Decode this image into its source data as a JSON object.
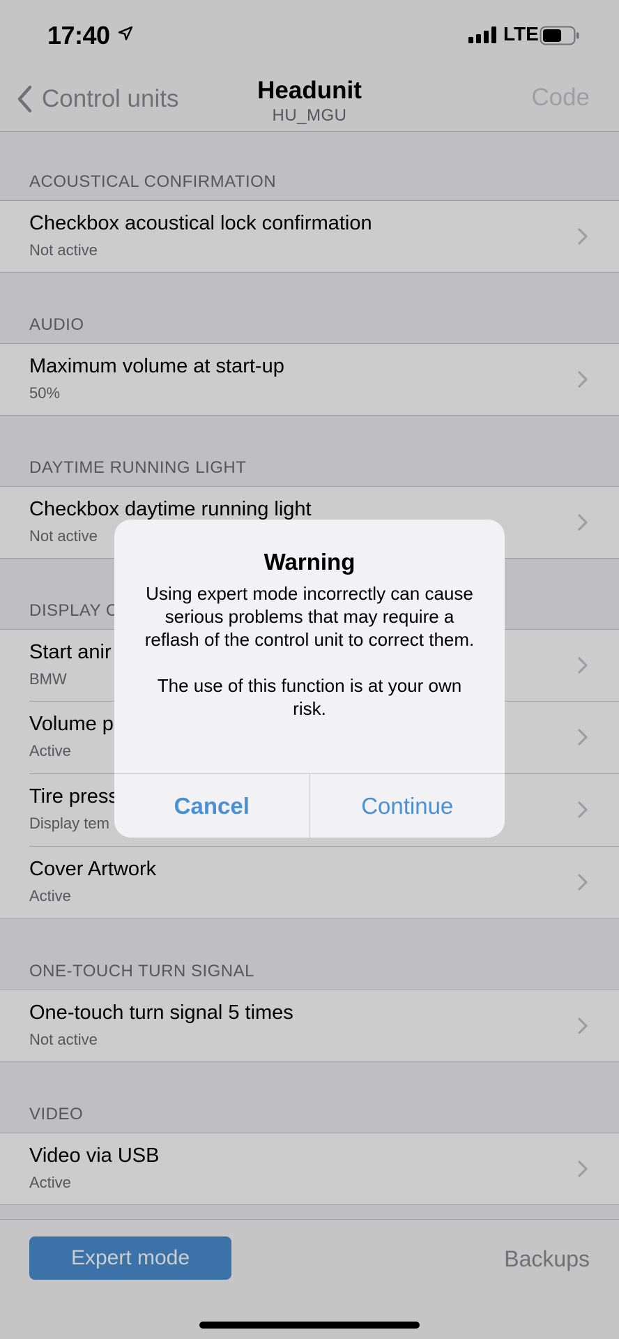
{
  "status_bar": {
    "time": "17:40",
    "network": "LTE"
  },
  "nav": {
    "back_label": "Control units",
    "title": "Headunit",
    "subtitle": "HU_MGU",
    "code_label": "Code"
  },
  "sections": [
    {
      "header": "ACOUSTICAL CONFIRMATION",
      "rows": [
        {
          "title": "Checkbox acoustical lock confirmation",
          "value": "Not active"
        }
      ]
    },
    {
      "header": "AUDIO",
      "rows": [
        {
          "title": "Maximum volume at start-up",
          "value": "50%"
        }
      ]
    },
    {
      "header": "DAYTIME RUNNING LIGHT",
      "rows": [
        {
          "title": "Checkbox daytime running light",
          "value": "Not active"
        }
      ]
    },
    {
      "header": "DISPLAY C",
      "rows": [
        {
          "title": "Start anir",
          "value": "BMW"
        },
        {
          "title": "Volume p",
          "value": "Active"
        },
        {
          "title": "Tire press",
          "value": "Display tem"
        },
        {
          "title": "Cover Artwork",
          "value": "Active"
        }
      ]
    },
    {
      "header": "ONE-TOUCH TURN SIGNAL",
      "rows": [
        {
          "title": "One-touch turn signal 5 times",
          "value": "Not active"
        }
      ]
    },
    {
      "header": "VIDEO",
      "rows": [
        {
          "title": "Video via USB",
          "value": "Active"
        }
      ]
    }
  ],
  "toolbar": {
    "expert_label": "Expert mode",
    "backups_label": "Backups"
  },
  "alert": {
    "title": "Warning",
    "message": "Using expert mode incorrectly can cause serious problems that may require a reflash of the control unit to correct them.\n\nThe use of this function is at your own risk.",
    "cancel_label": "Cancel",
    "continue_label": "Continue"
  },
  "colors": {
    "accent": "#4a90d2",
    "secondary_text": "#6d6d72",
    "separator": "#c8c8cc",
    "background": "#efeff4"
  },
  "icons": {
    "back": "chevron-left-icon",
    "disclosure": "chevron-right-icon",
    "location": "location-arrow-icon",
    "signal": "cellular-signal-icon",
    "battery": "battery-icon"
  }
}
